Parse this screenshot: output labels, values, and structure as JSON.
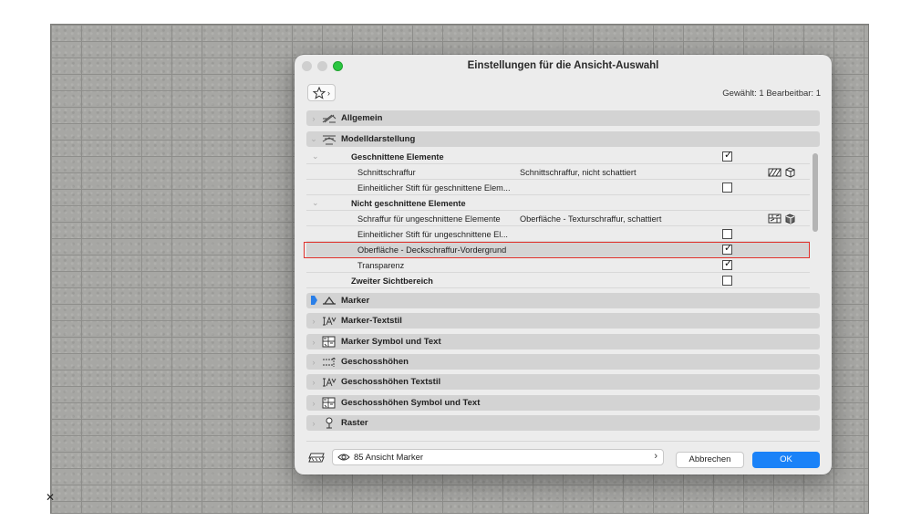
{
  "window": {
    "title": "Einstellungen für die Ansicht-Auswahl"
  },
  "toolbar": {
    "favorites_icon": "star-icon",
    "selected_info": "Gewählt: 1 Bearbeitbar: 1"
  },
  "panels": [
    {
      "label": "Allgemein",
      "expanded": false,
      "icon": "general-settings-icon"
    },
    {
      "label": "Modelldarstellung",
      "expanded": true,
      "icon": "model-display-icon"
    },
    {
      "label": "Marker",
      "expanded": false,
      "icon": "marker-icon"
    },
    {
      "label": "Marker-Textstil",
      "expanded": false,
      "icon": "text-style-icon"
    },
    {
      "label": "Marker Symbol und Text",
      "expanded": false,
      "icon": "symbol-text-icon"
    },
    {
      "label": "Geschosshöhen",
      "expanded": false,
      "icon": "story-levels-icon"
    },
    {
      "label": "Geschosshöhen Textstil",
      "expanded": false,
      "icon": "text-style-icon"
    },
    {
      "label": "Geschosshöhen Symbol und Text",
      "expanded": false,
      "icon": "symbol-text-icon"
    },
    {
      "label": "Raster",
      "expanded": false,
      "icon": "grid-pin-icon"
    }
  ],
  "tree_rows": [
    {
      "name": "Geschnittene Elemente",
      "group": true,
      "value": "",
      "checkbox": true,
      "checked": true,
      "icons": false
    },
    {
      "name": "Schnittschraffur",
      "group": false,
      "value": "Schnittschraffur, nicht schattiert",
      "checkbox": false,
      "checked": false,
      "icons": true
    },
    {
      "name": "Einheitlicher Stift für geschnittene Elem...",
      "group": false,
      "value": "",
      "checkbox": true,
      "checked": false,
      "icons": false
    },
    {
      "name": "Nicht geschnittene Elemente",
      "group": true,
      "value": "",
      "checkbox": false,
      "checked": false,
      "icons": false
    },
    {
      "name": "Schraffur für ungeschnittene Elemente",
      "group": false,
      "value": "Oberfläche - Texturschraffur, schattiert",
      "checkbox": false,
      "checked": false,
      "icons": true
    },
    {
      "name": "Einheitlicher Stift für ungeschnittene El...",
      "group": false,
      "value": "",
      "checkbox": true,
      "checked": false,
      "icons": false
    },
    {
      "name": "Oberfläche - Deckschraffur-Vordergrund",
      "group": false,
      "value": "",
      "checkbox": true,
      "checked": true,
      "icons": false,
      "highlighted": true
    },
    {
      "name": "Transparenz",
      "group": false,
      "value": "",
      "checkbox": true,
      "checked": true,
      "icons": false
    },
    {
      "name": "Zweiter Sichtbereich",
      "group": true,
      "value": "",
      "checkbox": true,
      "checked": false,
      "icons": false
    }
  ],
  "footer": {
    "view_label": "85 Ansicht Marker",
    "cancel_label": "Abbrechen",
    "ok_label": "OK"
  },
  "colors": {
    "accent": "#1a82f8",
    "highlight_border": "#e0322c",
    "window_bg": "#ececec",
    "panel_bg": "#d3d3d3"
  }
}
